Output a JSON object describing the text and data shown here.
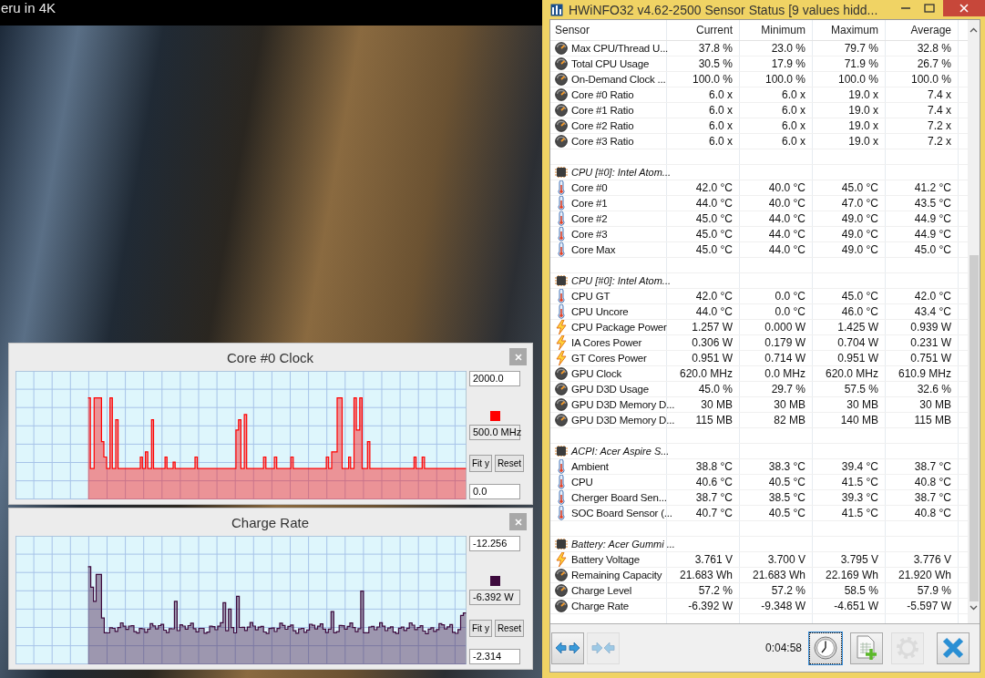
{
  "video": {
    "title": "eru in 4K"
  },
  "graphs": [
    {
      "title": "Core #0 Clock",
      "top_value": "2000.0",
      "current": "500.0 MHz",
      "bottom_value": "0.0",
      "color": "#ff0000",
      "buttons": [
        "Fit y",
        "Reset"
      ]
    },
    {
      "title": "Charge Rate",
      "top_value": "-12.256",
      "current": "-6.392 W",
      "bottom_value": "-2.314",
      "color": "#3d0a3d",
      "buttons": [
        "Fit y",
        "Reset"
      ]
    }
  ],
  "window": {
    "title": "HWiNFO32 v4.62-2500 Sensor Status [9 values hidd..."
  },
  "columns": [
    "Sensor",
    "Current",
    "Minimum",
    "Maximum",
    "Average"
  ],
  "sections": [
    {
      "rows": [
        {
          "kind": "gauge",
          "name": "Max CPU/Thread U...",
          "values": [
            "37.8 %",
            "23.0 %",
            "79.7 %",
            "32.8 %"
          ]
        },
        {
          "kind": "gauge",
          "name": "Total CPU Usage",
          "values": [
            "30.5 %",
            "17.9 %",
            "71.9 %",
            "26.7 %"
          ]
        },
        {
          "kind": "gauge",
          "name": "On-Demand Clock ...",
          "values": [
            "100.0 %",
            "100.0 %",
            "100.0 %",
            "100.0 %"
          ]
        },
        {
          "kind": "gauge",
          "name": "Core #0 Ratio",
          "values": [
            "6.0 x",
            "6.0 x",
            "19.0 x",
            "7.4 x"
          ]
        },
        {
          "kind": "gauge",
          "name": "Core #1 Ratio",
          "values": [
            "6.0 x",
            "6.0 x",
            "19.0 x",
            "7.4 x"
          ]
        },
        {
          "kind": "gauge",
          "name": "Core #2 Ratio",
          "values": [
            "6.0 x",
            "6.0 x",
            "19.0 x",
            "7.2 x"
          ]
        },
        {
          "kind": "gauge",
          "name": "Core #3 Ratio",
          "values": [
            "6.0 x",
            "6.0 x",
            "19.0 x",
            "7.2 x"
          ]
        }
      ]
    },
    {
      "header": "CPU [#0]: Intel Atom...",
      "rows": [
        {
          "kind": "temperature",
          "name": "Core #0",
          "values": [
            "42.0 °C",
            "40.0 °C",
            "45.0 °C",
            "41.2 °C"
          ]
        },
        {
          "kind": "temperature",
          "name": "Core #1",
          "values": [
            "44.0 °C",
            "40.0 °C",
            "47.0 °C",
            "43.5 °C"
          ]
        },
        {
          "kind": "temperature",
          "name": "Core #2",
          "values": [
            "45.0 °C",
            "44.0 °C",
            "49.0 °C",
            "44.9 °C"
          ]
        },
        {
          "kind": "temperature",
          "name": "Core #3",
          "values": [
            "45.0 °C",
            "44.0 °C",
            "49.0 °C",
            "44.9 °C"
          ]
        },
        {
          "kind": "temperature",
          "name": "Core Max",
          "values": [
            "45.0 °C",
            "44.0 °C",
            "49.0 °C",
            "45.0 °C"
          ]
        }
      ]
    },
    {
      "header": "CPU [#0]: Intel Atom...",
      "rows": [
        {
          "kind": "temperature",
          "name": "CPU GT",
          "values": [
            "42.0 °C",
            "0.0 °C",
            "45.0 °C",
            "42.0 °C"
          ]
        },
        {
          "kind": "temperature",
          "name": "CPU Uncore",
          "values": [
            "44.0 °C",
            "0.0 °C",
            "46.0 °C",
            "43.4 °C"
          ]
        },
        {
          "kind": "power",
          "name": "CPU Package Power",
          "values": [
            "1.257 W",
            "0.000 W",
            "1.425 W",
            "0.939 W"
          ]
        },
        {
          "kind": "power",
          "name": "IA Cores Power",
          "values": [
            "0.306 W",
            "0.179 W",
            "0.704 W",
            "0.231 W"
          ]
        },
        {
          "kind": "power",
          "name": "GT Cores Power",
          "values": [
            "0.951 W",
            "0.714 W",
            "0.951 W",
            "0.751 W"
          ]
        },
        {
          "kind": "gauge",
          "name": "GPU Clock",
          "values": [
            "620.0 MHz",
            "0.0 MHz",
            "620.0 MHz",
            "610.9 MHz"
          ]
        },
        {
          "kind": "gauge",
          "name": "GPU D3D Usage",
          "values": [
            "45.0 %",
            "29.7 %",
            "57.5 %",
            "32.6 %"
          ]
        },
        {
          "kind": "gauge",
          "name": "GPU D3D Memory D...",
          "values": [
            "30 MB",
            "30 MB",
            "30 MB",
            "30 MB"
          ]
        },
        {
          "kind": "gauge",
          "name": "GPU D3D Memory D...",
          "values": [
            "115 MB",
            "82 MB",
            "140 MB",
            "115 MB"
          ]
        }
      ]
    },
    {
      "header": "ACPI: Acer Aspire S...",
      "rows": [
        {
          "kind": "temperature",
          "name": "Ambient",
          "values": [
            "38.8 °C",
            "38.3 °C",
            "39.4 °C",
            "38.7 °C"
          ]
        },
        {
          "kind": "temperature",
          "name": "CPU",
          "values": [
            "40.6 °C",
            "40.5 °C",
            "41.5 °C",
            "40.8 °C"
          ]
        },
        {
          "kind": "temperature",
          "name": "Cherger Board Sen...",
          "values": [
            "38.7 °C",
            "38.5 °C",
            "39.3 °C",
            "38.7 °C"
          ]
        },
        {
          "kind": "temperature",
          "name": "SOC Board Sensor (...",
          "values": [
            "40.7 °C",
            "40.5 °C",
            "41.5 °C",
            "40.8 °C"
          ]
        }
      ]
    },
    {
      "header": "Battery: Acer Gummi ...",
      "rows": [
        {
          "kind": "power",
          "name": "Battery Voltage",
          "values": [
            "3.761 V",
            "3.700 V",
            "3.795 V",
            "3.776 V"
          ]
        },
        {
          "kind": "gauge",
          "name": "Remaining Capacity",
          "values": [
            "21.683 Wh",
            "21.683 Wh",
            "22.169 Wh",
            "21.920 Wh"
          ]
        },
        {
          "kind": "gauge",
          "name": "Charge Level",
          "values": [
            "57.2 %",
            "57.2 %",
            "58.5 %",
            "57.9 %"
          ]
        },
        {
          "kind": "gauge",
          "name": "Charge Rate",
          "values": [
            "-6.392 W",
            "-9.348 W",
            "-4.651 W",
            "-5.597 W"
          ]
        }
      ]
    }
  ],
  "toolbar": {
    "timer": "0:04:58",
    "buttons": [
      {
        "kind": "expand",
        "disabled": false,
        "focused": false
      },
      {
        "kind": "collapse",
        "disabled": true,
        "focused": false
      },
      {
        "kind": "clock",
        "disabled": false,
        "focused": true
      },
      {
        "kind": "report",
        "disabled": false,
        "focused": false
      },
      {
        "kind": "settings",
        "disabled": true,
        "focused": false
      },
      {
        "kind": "close",
        "disabled": false,
        "focused": false
      }
    ]
  }
}
